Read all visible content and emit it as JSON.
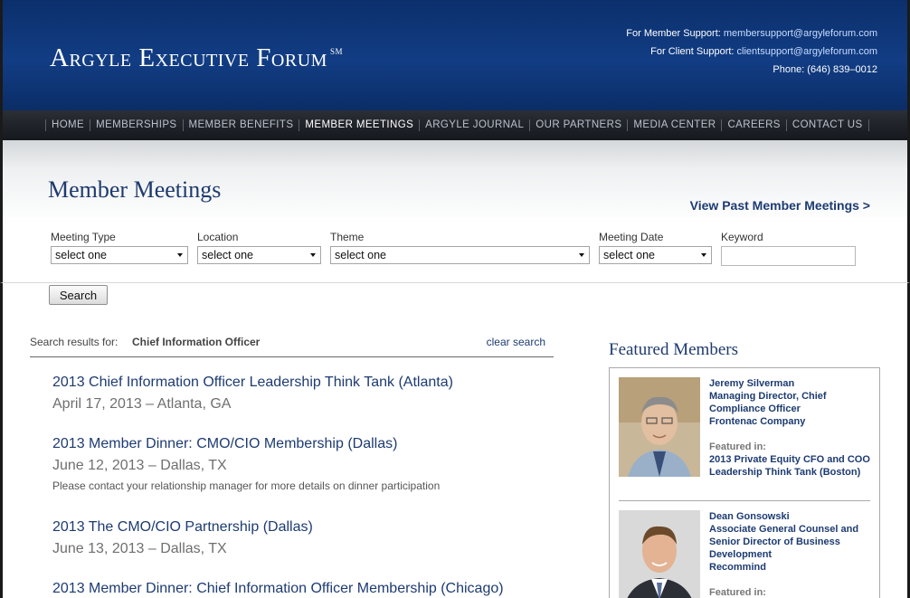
{
  "header": {
    "logo": "Argyle Executive Forum",
    "logo_mark": "SM",
    "member_support_label": "For Member Support:",
    "member_support_email": "membersupport@argyleforum.com",
    "client_support_label": "For Client Support:",
    "client_support_email": "clientsupport@argyleforum.com",
    "phone": "Phone: (646) 839–0012"
  },
  "nav": {
    "items": [
      {
        "label": "HOME"
      },
      {
        "label": "MEMBERSHIPS"
      },
      {
        "label": "MEMBER BENEFITS"
      },
      {
        "label": "MEMBER MEETINGS"
      },
      {
        "label": "ARGYLE JOURNAL"
      },
      {
        "label": "OUR PARTNERS"
      },
      {
        "label": "MEDIA CENTER"
      },
      {
        "label": "CAREERS"
      },
      {
        "label": "CONTACT US"
      }
    ],
    "active": "MEMBER MEETINGS"
  },
  "page": {
    "title": "Member Meetings",
    "view_past_link": "View Past Member Meetings >"
  },
  "filters": {
    "meeting_type": {
      "label": "Meeting Type",
      "value": "select one"
    },
    "location": {
      "label": "Location",
      "value": "select one"
    },
    "theme": {
      "label": "Theme",
      "value": "select one"
    },
    "meeting_date": {
      "label": "Meeting Date",
      "value": "select one"
    },
    "keyword": {
      "label": "Keyword",
      "value": ""
    },
    "search_button": "Search"
  },
  "results": {
    "label": "Search results for:",
    "query": "Chief Information Officer",
    "clear_link": "clear search",
    "items": [
      {
        "title": "2013 Chief Information Officer Leadership Think Tank (Atlanta)",
        "date": "April 17, 2013 – Atlanta, GA",
        "note": ""
      },
      {
        "title": "2013 Member Dinner: CMO/CIO Membership (Dallas)",
        "date": "June 12, 2013 – Dallas, TX",
        "note": "Please contact your relationship manager for more details on dinner participation"
      },
      {
        "title": "2013 The CMO/CIO Partnership (Dallas)",
        "date": "June 13, 2013 – Dallas, TX",
        "note": ""
      },
      {
        "title": "2013 Member Dinner: Chief Information Officer Membership (Chicago)",
        "date": "",
        "note": ""
      }
    ]
  },
  "featured": {
    "heading": "Featured Members",
    "members": [
      {
        "name": "Jeremy Silverman",
        "title": "Managing Director, Chief Compliance Officer",
        "company": "Frontenac Company",
        "featured_in_label": "Featured in:",
        "featured_in": "2013 Private Equity CFO and COO Leadership Think Tank (Boston)"
      },
      {
        "name": "Dean Gonsowski",
        "title": "Associate General Counsel and Senior Director of Business Development",
        "company": "Recommind",
        "featured_in_label": "Featured in:",
        "featured_in": ""
      }
    ]
  }
}
